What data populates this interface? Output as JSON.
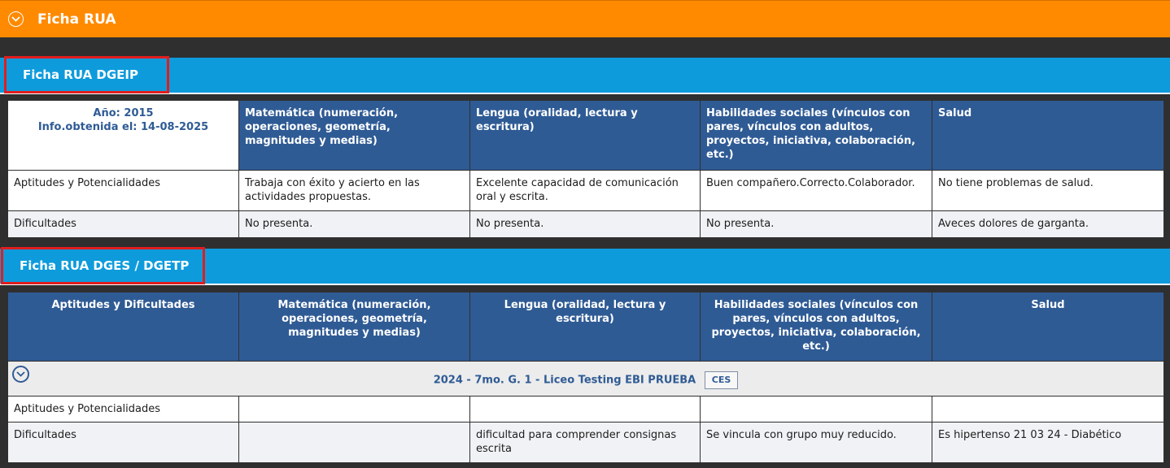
{
  "header": {
    "title": "Ficha RUA",
    "toggle_icon": "chevron-down-circle-icon"
  },
  "dgeip": {
    "title": "Ficha RUA DGEIP",
    "year_label": "Año: 2015",
    "info_label": "Info.obtenida el: 14-08-2025",
    "columns": [
      "Matemática (numeración, operaciones, geometría, magnitudes y medias)",
      "Lengua (oralidad, lectura y escritura)",
      "Habilidades sociales (vínculos con pares, vínculos con adultos, proyectos, iniciativa, colaboración, etc.)",
      "Salud"
    ],
    "rows": [
      {
        "label": "Aptitudes y Potencialidades",
        "cells": [
          "Trabaja con éxito y acierto en las actividades propuestas.",
          "Excelente capacidad de comunicación oral y escrita.",
          "Buen compañero.Correcto.Colaborador.",
          "No tiene problemas de salud."
        ]
      },
      {
        "label": "Dificultades",
        "cells": [
          "No presenta.",
          "No presenta.",
          "No presenta.",
          "Aveces dolores de garganta."
        ]
      }
    ]
  },
  "dges": {
    "title": "Ficha RUA DGES / DGETP",
    "first_col_header": "Aptitudes y Dificultades",
    "columns": [
      "Matemática (numeración, operaciones, geometría, magnitudes y medias)",
      "Lengua (oralidad, lectura y escritura)",
      "Habilidades sociales (vínculos con pares, vínculos con adultos, proyectos, iniciativa, colaboración, etc.)",
      "Salud"
    ],
    "group": {
      "label": "2024 - 7mo. G. 1 - Liceo Testing EBI PRUEBA",
      "badge": "CES",
      "toggle_icon": "chevron-down-circle-icon"
    },
    "rows": [
      {
        "label": "Aptitudes y Potencialidades",
        "cells": [
          "",
          "",
          "",
          ""
        ]
      },
      {
        "label": "Dificultades",
        "cells": [
          "",
          "dificultad para comprender consignas escrita",
          "Se vincula con grupo muy reducido.",
          "Es hipertenso 21 03 24 - Diabético"
        ]
      }
    ]
  }
}
